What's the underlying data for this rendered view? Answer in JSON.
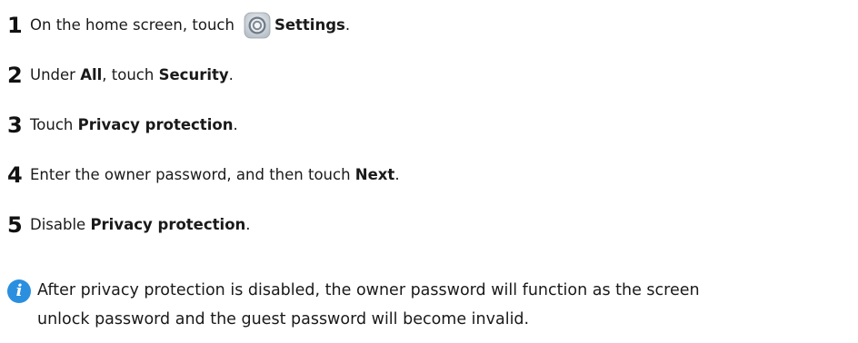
{
  "steps": [
    {
      "number": "1",
      "pre": "On the home screen, touch",
      "bold": "Settings",
      "post": ".",
      "icon": "settings-gear-icon"
    },
    {
      "number": "2",
      "pre": "Under ",
      "bold1": "All",
      "mid": ", touch ",
      "bold2": "Security",
      "post": "."
    },
    {
      "number": "3",
      "pre": "Touch ",
      "bold": "Privacy protection",
      "post": "."
    },
    {
      "number": "4",
      "pre": "Enter the owner password, and then touch ",
      "bold": "Next",
      "post": "."
    },
    {
      "number": "5",
      "pre": "Disable ",
      "bold": "Privacy protection",
      "post": "."
    }
  ],
  "note": {
    "icon": "info-icon",
    "icon_glyph": "i",
    "icon_color": "#2b8fe0",
    "line1": "After privacy protection is disabled, the owner password will function as the screen",
    "line2": "unlock password and the guest password will become invalid."
  }
}
